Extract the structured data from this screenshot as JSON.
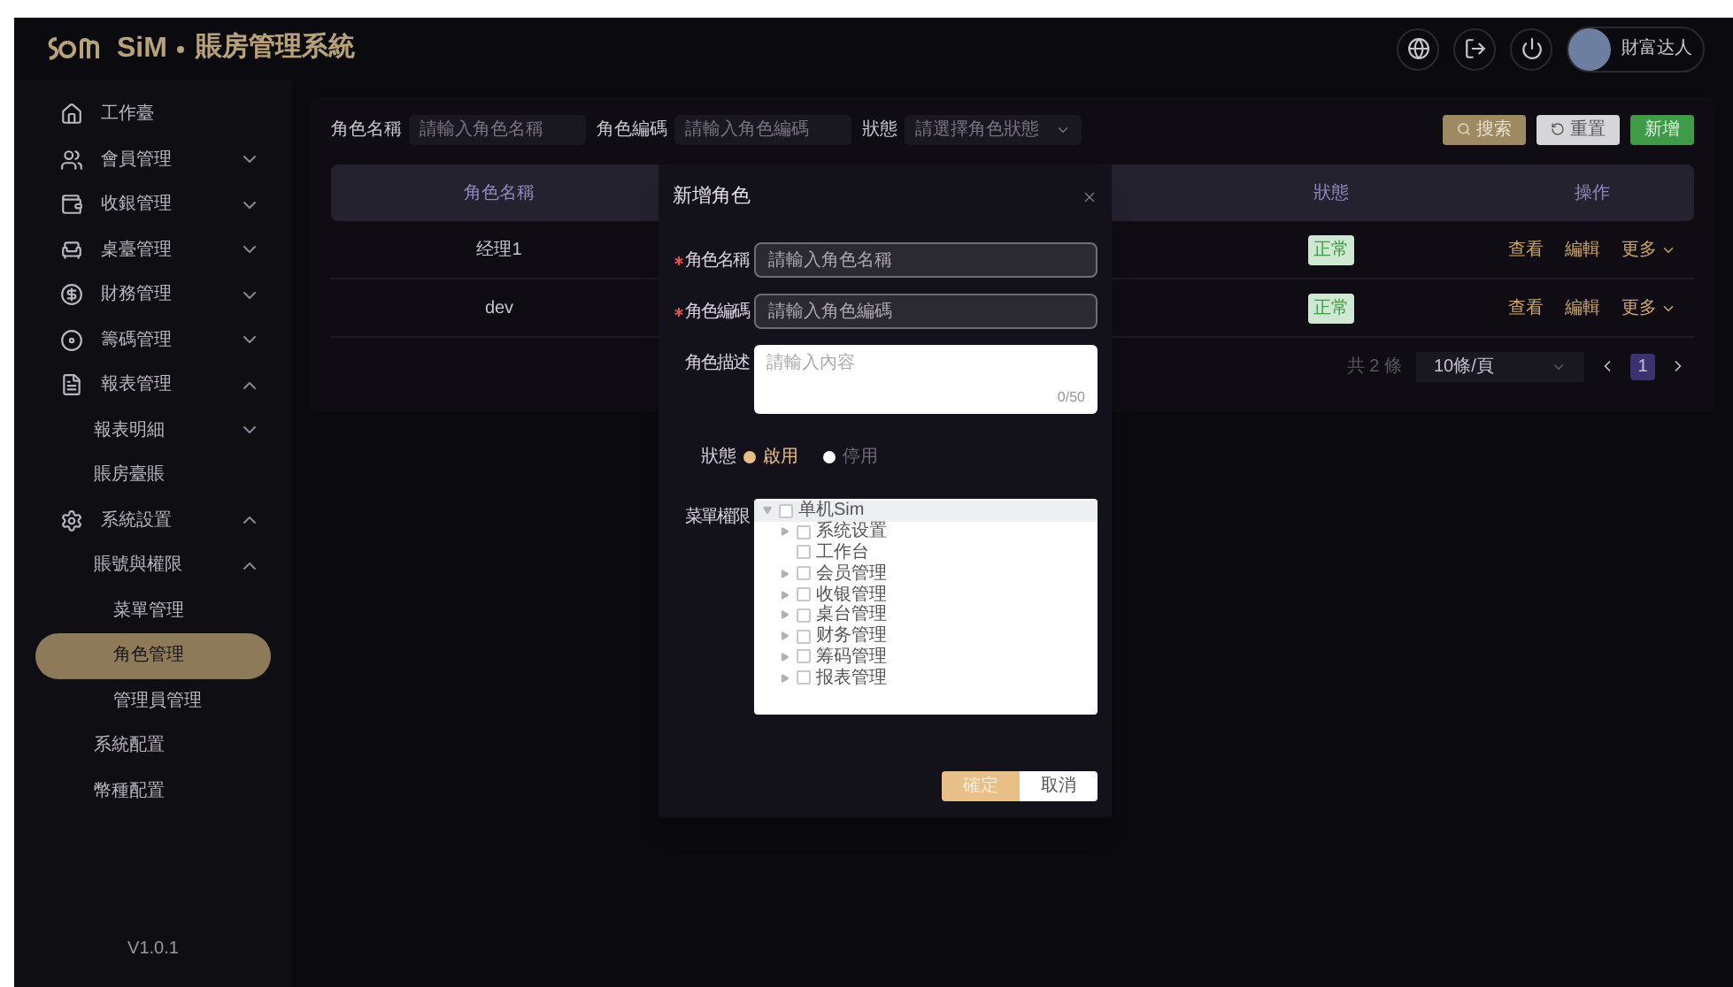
{
  "header": {
    "brand": "SiM",
    "title": "賬房管理系統",
    "user": "財富达人"
  },
  "sidebar": {
    "items": [
      {
        "label": "工作臺",
        "selected": false
      },
      {
        "label": "會員管理",
        "selected": false,
        "expanded": false
      },
      {
        "label": "收銀管理",
        "selected": false,
        "expanded": false
      },
      {
        "label": "桌臺管理",
        "selected": false,
        "expanded": false
      },
      {
        "label": "財務管理",
        "selected": false,
        "expanded": false
      },
      {
        "label": "籌碼管理",
        "selected": false,
        "expanded": false
      },
      {
        "label": "報表管理",
        "selected": false,
        "expanded": true,
        "children": [
          {
            "label": "報表明細",
            "selected": false,
            "expanded": false
          },
          {
            "label": "賬房臺賬",
            "selected": false
          }
        ]
      },
      {
        "label": "系統設置",
        "selected": false,
        "expanded": true,
        "children": [
          {
            "label": "賬號與權限",
            "selected": false,
            "expanded": true,
            "children": [
              {
                "label": "菜單管理",
                "selected": false
              },
              {
                "label": "角色管理",
                "selected": true
              },
              {
                "label": "管理員管理",
                "selected": false
              }
            ]
          },
          {
            "label": "系統配置",
            "selected": false
          },
          {
            "label": "幣種配置",
            "selected": false
          }
        ]
      }
    ],
    "version": "V1.0.1"
  },
  "filters": [
    {
      "label": "角色名稱",
      "placeholder": "請輸入角色名稱",
      "kind": "input"
    },
    {
      "label": "角色編碼",
      "placeholder": "請輸入角色編碼",
      "kind": "input"
    },
    {
      "label": "狀態",
      "placeholder": "請選擇角色狀態",
      "kind": "select"
    }
  ],
  "toolbar": [
    {
      "label": "搜索",
      "kind": "search"
    },
    {
      "label": "重置",
      "kind": "reset"
    },
    {
      "label": "新增",
      "kind": "add"
    }
  ],
  "table": {
    "columns": [
      "角色名稱",
      "狀態",
      "操作"
    ],
    "rows": [
      {
        "name": "经理1",
        "status": "正常",
        "actions": [
          "查看",
          "編輯",
          "更多"
        ]
      },
      {
        "name": "dev",
        "status": "正常",
        "actions": [
          "查看",
          "編輯",
          "更多"
        ]
      }
    ]
  },
  "pagination": {
    "total": "共 2 條",
    "page_size": "10條/頁",
    "pages": [
      {
        "label": "1",
        "selected": true
      }
    ]
  },
  "dialog": {
    "title": "新增角色",
    "fields": [
      {
        "label": "角色名稱",
        "required": true,
        "placeholder": "請輸入角色名稱",
        "kind": "input"
      },
      {
        "label": "角色編碼",
        "required": true,
        "placeholder": "請輸入角色編碼",
        "kind": "input"
      },
      {
        "label": "角色描述",
        "required": false,
        "placeholder": "請輸入內容",
        "counter": "0/50",
        "kind": "textarea"
      }
    ],
    "status": {
      "label": "狀態",
      "options": [
        {
          "label": "啟用",
          "selected": true
        },
        {
          "label": "停用",
          "selected": false
        }
      ]
    },
    "menu_permissions": {
      "label": "菜單權限",
      "tree": [
        {
          "label": "单机Sim",
          "checked": false,
          "selected": true,
          "expanded": true,
          "children": [
            {
              "label": "系统设置",
              "checked": false,
              "selected": false,
              "expanded": false
            },
            {
              "label": "工作台",
              "checked": false,
              "selected": false
            },
            {
              "label": "会员管理",
              "checked": false,
              "selected": false,
              "expanded": false
            },
            {
              "label": "收银管理",
              "checked": false,
              "selected": false,
              "expanded": false
            },
            {
              "label": "桌台管理",
              "checked": false,
              "selected": false,
              "expanded": false
            },
            {
              "label": "财务管理",
              "checked": false,
              "selected": false,
              "expanded": false
            },
            {
              "label": "筹码管理",
              "checked": false,
              "selected": false,
              "expanded": false
            },
            {
              "label": "报表管理",
              "checked": false,
              "selected": false,
              "expanded": false
            }
          ]
        }
      ]
    },
    "buttons": [
      {
        "label": "確定",
        "kind": "primary"
      },
      {
        "label": "取消",
        "kind": "secondary"
      }
    ]
  }
}
